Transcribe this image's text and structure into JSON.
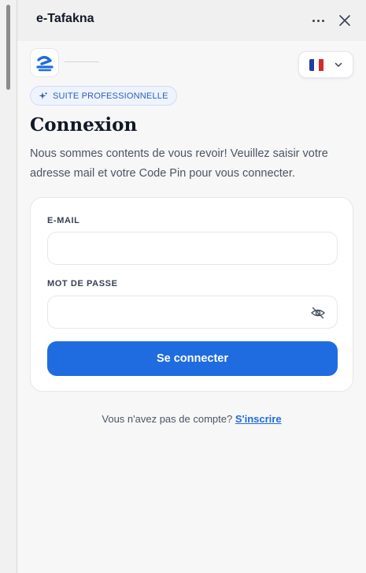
{
  "window": {
    "title": "e-Tafakna"
  },
  "header": {
    "more_icon": "more-horizontal-icon",
    "close_icon": "close-icon"
  },
  "language": {
    "flag": "france-flag",
    "flag_colors": [
      "#1f3fa0",
      "#ffffff",
      "#d42a2a"
    ]
  },
  "badge": {
    "label": "SUITE PROFESSIONNELLE",
    "icon": "sparkle-icon"
  },
  "login": {
    "heading": "Connexion",
    "subtitle": "Nous sommes contents de vous revoir! Veuillez saisir votre adresse mail et votre Code Pin pour vous connecter.",
    "email_label": "E-MAIL",
    "email_value": "",
    "password_label": "MOT DE PASSE",
    "password_value": "",
    "submit_label": "Se connecter"
  },
  "signup": {
    "prompt": "Vous n'avez pas de compte?",
    "link": "S'inscrire"
  },
  "colors": {
    "accent": "#1f6ce0",
    "background": "#f7f7f7"
  }
}
